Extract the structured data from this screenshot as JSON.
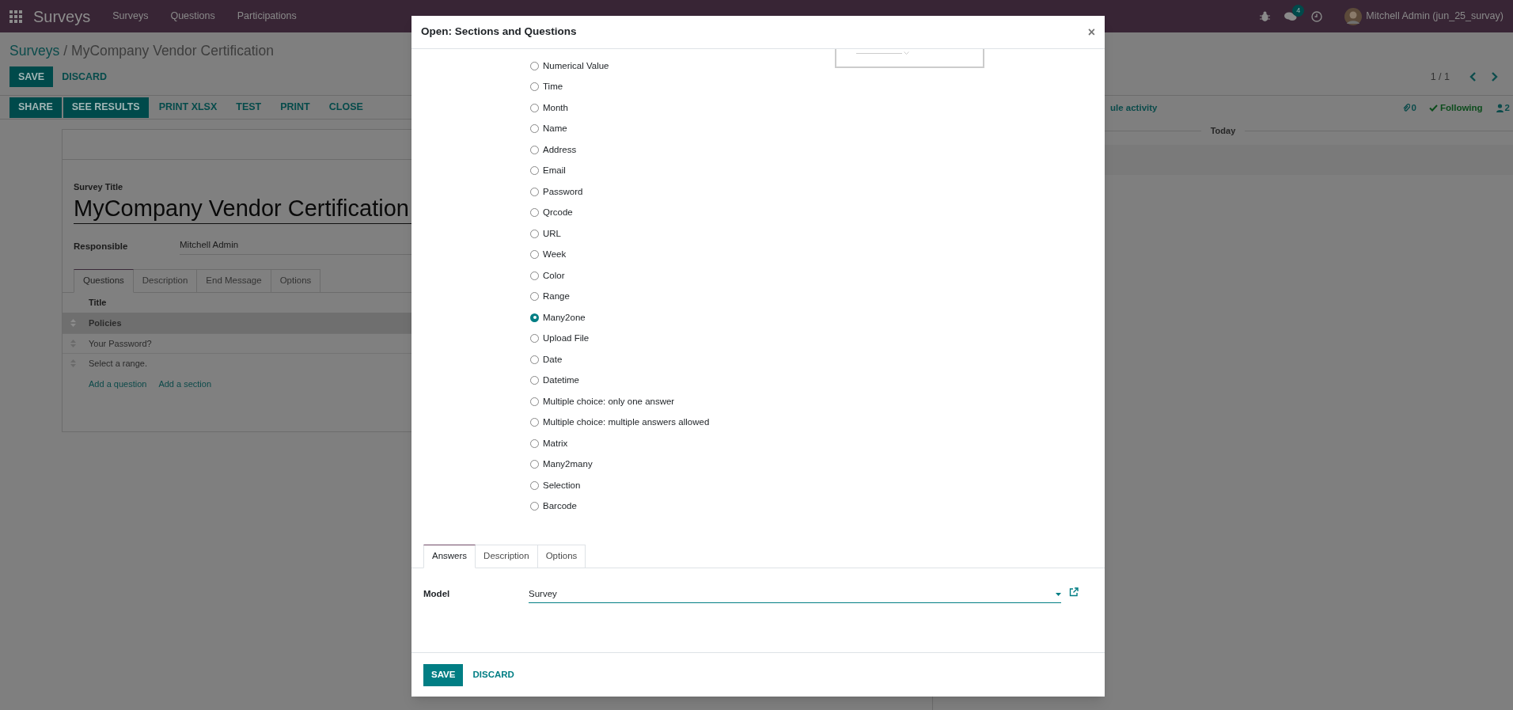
{
  "navbar": {
    "app_name": "Surveys",
    "menu": [
      "Surveys",
      "Questions",
      "Participations"
    ],
    "messages_count": "4",
    "user": "Mitchell Admin (jun_25_survay)"
  },
  "breadcrumb": {
    "parent": "Surveys",
    "separator": "/",
    "current": "MyCompany Vendor Certification"
  },
  "control_buttons": [
    {
      "label": "SAVE",
      "primary": true
    },
    {
      "label": "DISCARD",
      "primary": false
    }
  ],
  "pager": "1 / 1",
  "header_buttons": [
    {
      "label": "SHARE",
      "primary": true
    },
    {
      "label": "SEE RESULTS",
      "primary": true
    },
    {
      "label": "PRINT XLSX",
      "primary": false
    },
    {
      "label": "TEST",
      "primary": false
    },
    {
      "label": "PRINT",
      "primary": false
    },
    {
      "label": "CLOSE",
      "primary": false
    }
  ],
  "chatter": {
    "schedule": "ule activity",
    "attachments": "0",
    "following": "Following",
    "followers": "2",
    "date_separator": "Today"
  },
  "form": {
    "title_label": "Survey Title",
    "title": "MyCompany Vendor Certification",
    "responsible_label": "Responsible",
    "responsible": "Mitchell Admin",
    "tabs": [
      {
        "label": "Questions",
        "selected": true
      },
      {
        "label": "Description",
        "selected": false
      },
      {
        "label": "End Message",
        "selected": false
      },
      {
        "label": "Options",
        "selected": false
      }
    ],
    "column": "Title",
    "rows": [
      {
        "title": "Policies",
        "kind": "section"
      },
      {
        "title": "Your Password?",
        "kind": "question"
      },
      {
        "title": "Select a range.",
        "kind": "question"
      }
    ],
    "add_links": [
      "Add a question",
      "Add a section"
    ]
  },
  "dialog": {
    "title": "Open: Sections and Questions",
    "close": "×",
    "question_types": [
      {
        "label": "Numerical Value",
        "selected": false
      },
      {
        "label": "Time",
        "selected": false
      },
      {
        "label": "Month",
        "selected": false
      },
      {
        "label": "Name",
        "selected": false
      },
      {
        "label": "Address",
        "selected": false
      },
      {
        "label": "Email",
        "selected": false
      },
      {
        "label": "Password",
        "selected": false
      },
      {
        "label": "Qrcode",
        "selected": false
      },
      {
        "label": "URL",
        "selected": false
      },
      {
        "label": "Week",
        "selected": false
      },
      {
        "label": "Color",
        "selected": false
      },
      {
        "label": "Range",
        "selected": false
      },
      {
        "label": "Many2one",
        "selected": true
      },
      {
        "label": "Upload File",
        "selected": false
      },
      {
        "label": "Date",
        "selected": false
      },
      {
        "label": "Datetime",
        "selected": false
      },
      {
        "label": "Multiple choice: only one answer",
        "selected": false
      },
      {
        "label": "Multiple choice: multiple answers allowed",
        "selected": false
      },
      {
        "label": "Matrix",
        "selected": false
      },
      {
        "label": "Many2many",
        "selected": false
      },
      {
        "label": "Selection",
        "selected": false
      },
      {
        "label": "Barcode",
        "selected": false
      }
    ],
    "tabs": [
      {
        "label": "Answers",
        "selected": true
      },
      {
        "label": "Description",
        "selected": false
      },
      {
        "label": "Options",
        "selected": false
      }
    ],
    "model_label": "Model",
    "model_value": "Survey",
    "buttons": [
      {
        "label": "SAVE",
        "primary": true
      },
      {
        "label": "DISCARD",
        "primary": false
      }
    ]
  }
}
